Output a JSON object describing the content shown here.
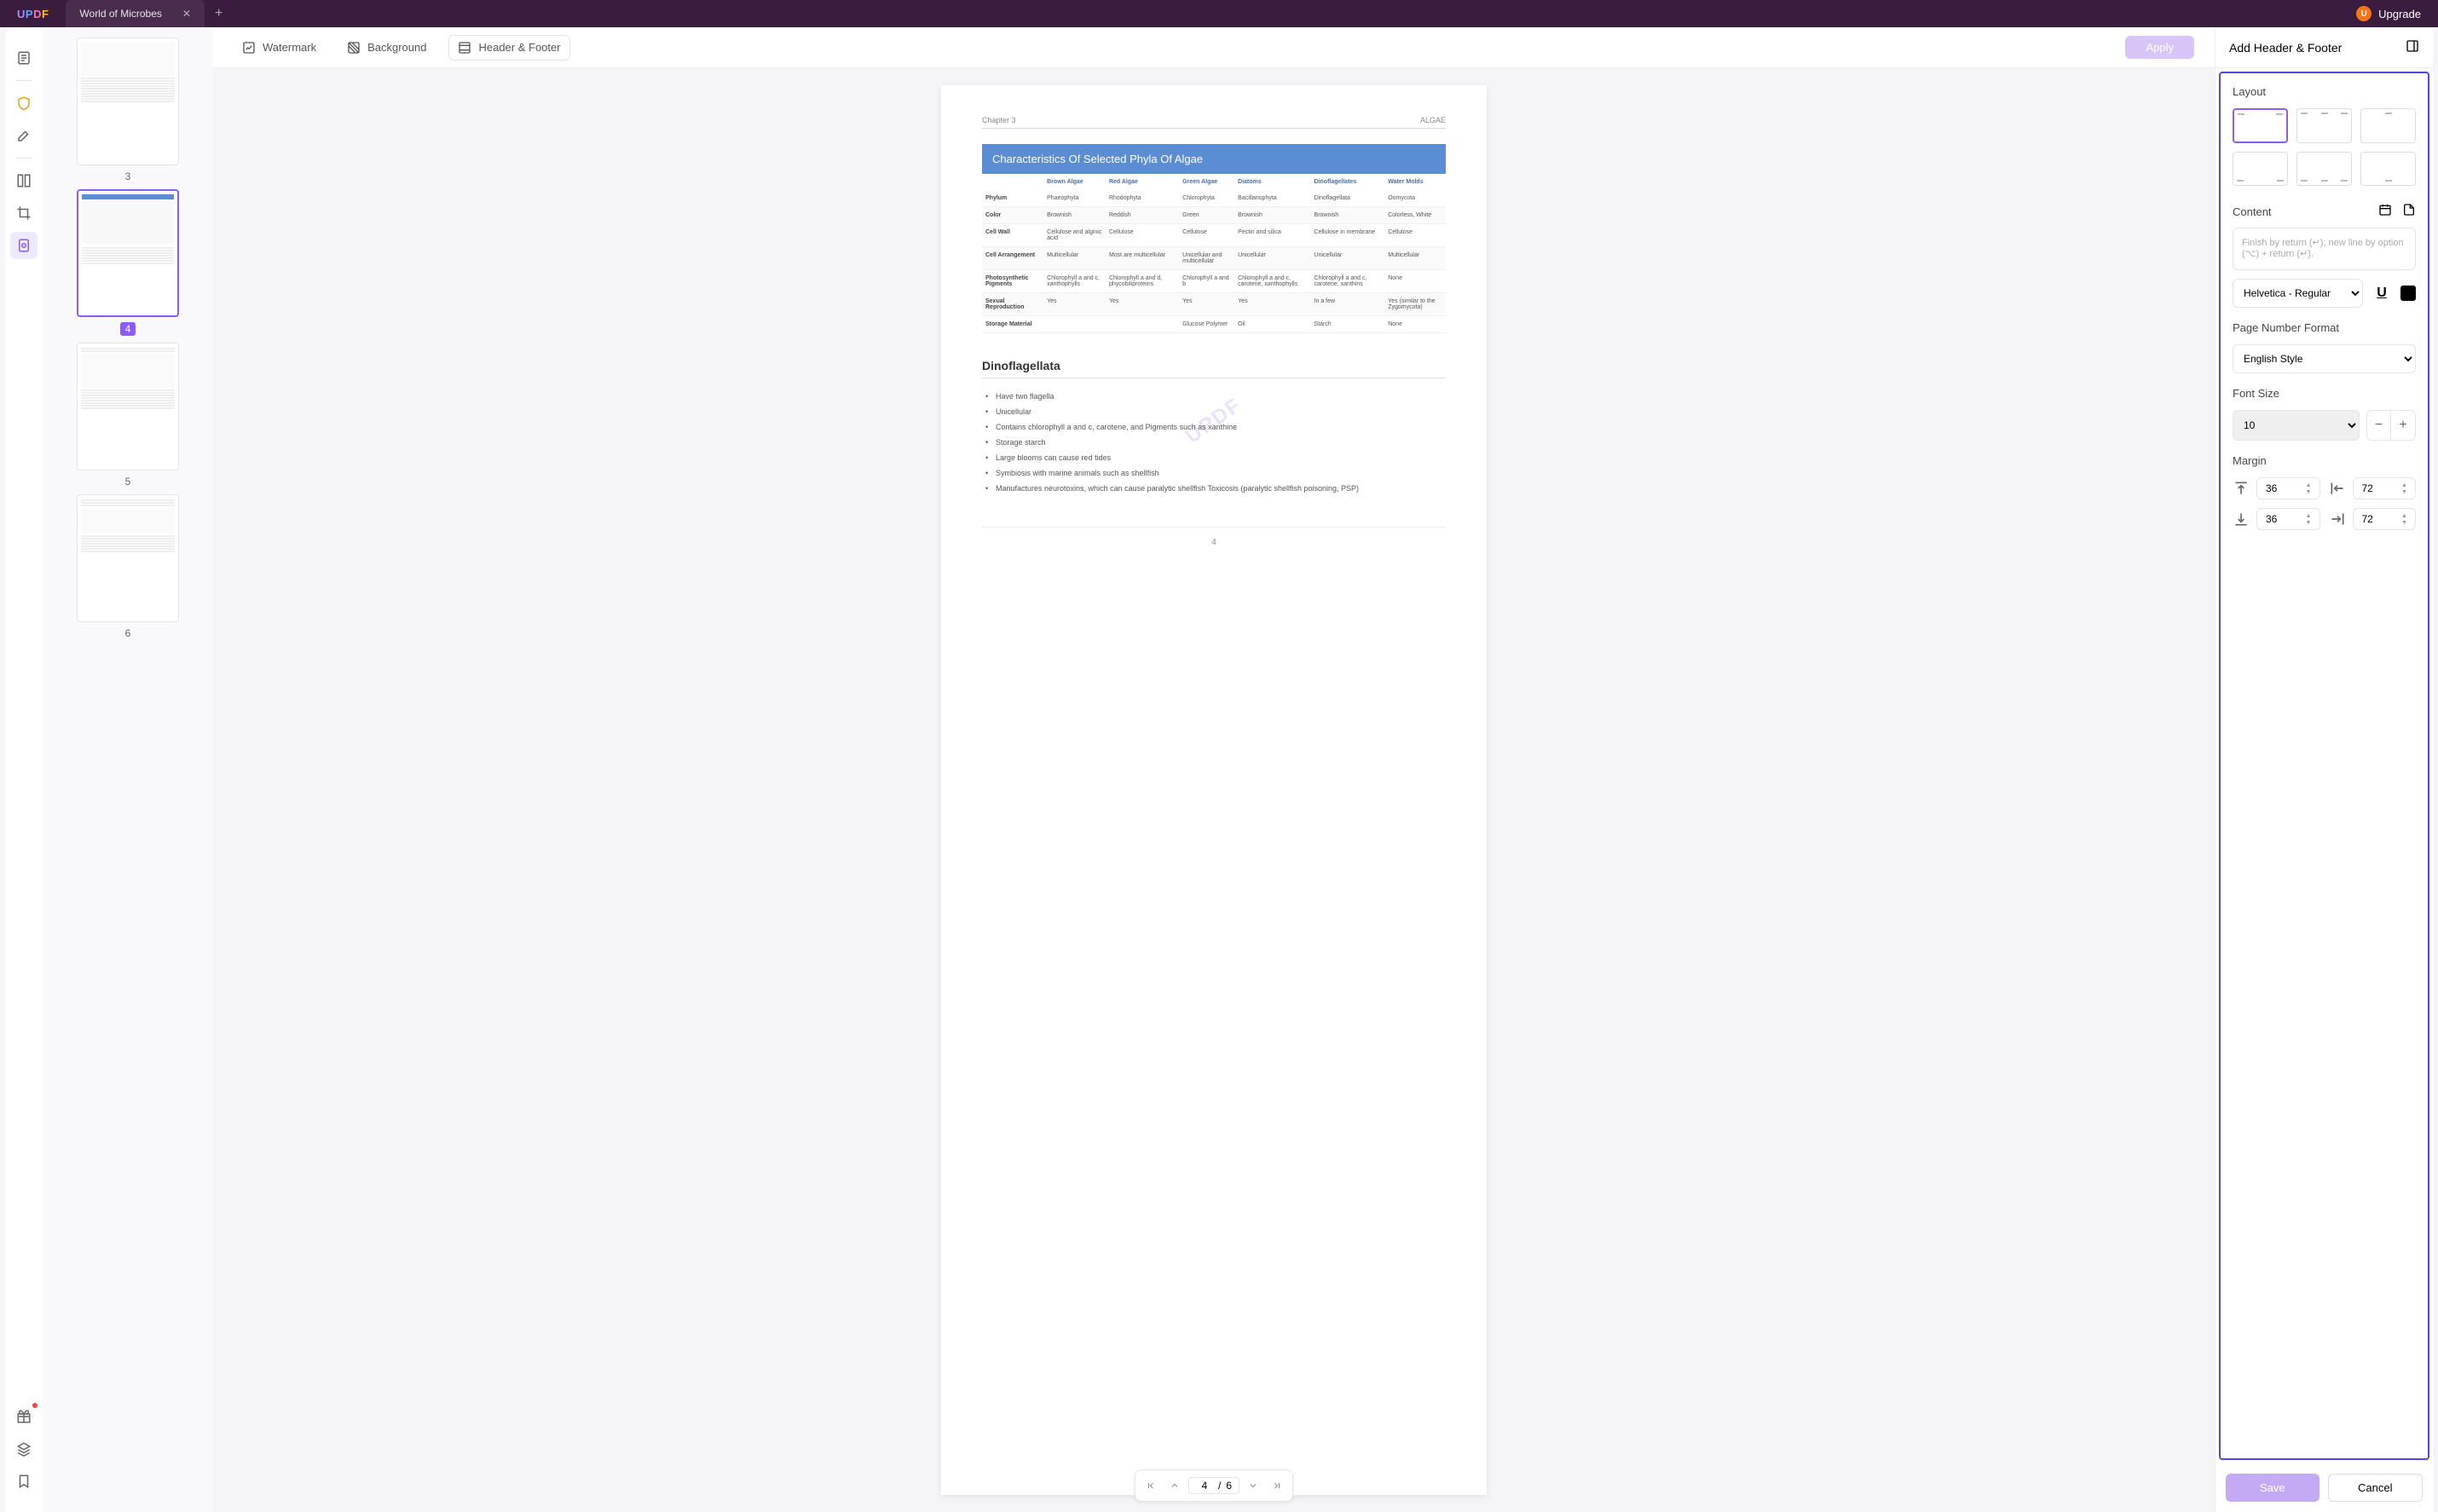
{
  "app": {
    "logo": "UPDF",
    "tab_title": "World of Microbes",
    "upgrade": "Upgrade",
    "avatar_letter": "U"
  },
  "top_tools": {
    "watermark": "Watermark",
    "background": "Background",
    "header_footer": "Header & Footer",
    "apply": "Apply"
  },
  "thumbnails": [
    {
      "num": "3",
      "selected": false
    },
    {
      "num": "4",
      "selected": true
    },
    {
      "num": "5",
      "selected": false
    },
    {
      "num": "6",
      "selected": false
    }
  ],
  "page": {
    "chapter": "Chapter 3",
    "topic": "ALGAE",
    "table_title": "Characteristics Of Selected Phyla Of Algae",
    "watermark_text": "UPDF",
    "dino_title": "Dinoflagellata",
    "page_number": "4",
    "bullets": [
      "Have two flagella",
      "Unicellular",
      "Contains chlorophyll a and c, carotene, and Pigments such as xanthine",
      "Storage starch",
      "Large blooms can cause red tides",
      "Symbiosis with marine animals such as shellfish",
      "Manufactures neurotoxins, which can cause paralytic shellfish Toxicosis (paralytic shellfish poisoning, PSP)"
    ],
    "table": {
      "headers": [
        "",
        "Brown Algae",
        "Red Algae",
        "Green Algae",
        "Diatoms",
        "Dinoflagellates",
        "Water Molds"
      ],
      "rows": [
        [
          "Phylum",
          "Phaeophyta",
          "Rhodophyta",
          "Chlorophyta",
          "Bacillariophyta",
          "Dinoflagellata",
          "Oomycota"
        ],
        [
          "Color",
          "Brownish",
          "Reddish",
          "Green",
          "Brownish",
          "Brownish",
          "Colorless, White"
        ],
        [
          "Cell Wall",
          "Cellulose and alginic acid",
          "Cellulose",
          "Cellulose",
          "Pectin and silica",
          "Cellulose in membrane",
          "Cellulose"
        ],
        [
          "Cell Arrangement",
          "Multicellular",
          "Most are multicellular",
          "Unicellular and multicellular",
          "Unicellular",
          "Unicellular",
          "Multicellular"
        ],
        [
          "Photosynthetic Pigments",
          "Chlorophyll a and c, xanthophylls",
          "Chlorophyll a and d, phycobiliproteins",
          "Chlorophyll a and b",
          "Chlorophyll a and c, carotene, xanthophylls",
          "Chlorophyll a and c, carotene, xanthins",
          "None"
        ],
        [
          "Sexual Reproduction",
          "Yes",
          "Yes",
          "Yes",
          "Yes",
          "In a few",
          "Yes (similar to the Zygomycota)"
        ],
        [
          "Storage Material",
          "",
          "",
          "Glucose Polymer",
          "Oil",
          "Starch",
          "None"
        ]
      ]
    }
  },
  "nav": {
    "current": "4",
    "total": "6",
    "sep": "/"
  },
  "panel": {
    "title": "Add Header & Footer",
    "layout_label": "Layout",
    "content_label": "Content",
    "content_placeholder": "Finish by return (↵); new line by option (⌥) + return (↵).",
    "font": "Helvetica - Regular",
    "page_format_label": "Page Number Format",
    "page_format_value": "English Style",
    "font_size_label": "Font Size",
    "font_size_value": "10",
    "margin_label": "Margin",
    "margins": {
      "top": "36",
      "left": "72",
      "bottom": "36",
      "right": "72"
    },
    "save": "Save",
    "cancel": "Cancel"
  }
}
